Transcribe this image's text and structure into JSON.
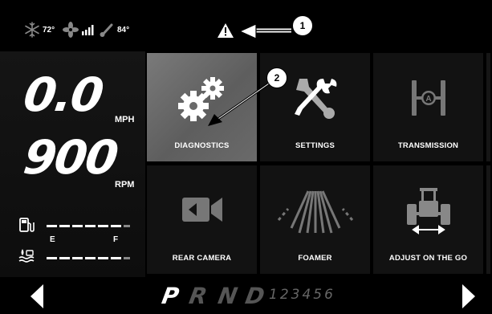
{
  "status": {
    "cab_temp": "72°",
    "fan_level": "",
    "ambient_temp": "84°"
  },
  "speed": {
    "value": "0.0",
    "unit": "MPH"
  },
  "rpm": {
    "value": "900",
    "unit": "RPM"
  },
  "fuel_gauge": {
    "empty_label": "E",
    "full_label": "F"
  },
  "tiles": [
    {
      "label": "DIAGNOSTICS",
      "icon": "gears-icon",
      "selected": true
    },
    {
      "label": "SETTINGS",
      "icon": "wrench-screwdriver-icon"
    },
    {
      "label": "TRANSMISSION",
      "icon": "transmission-icon"
    },
    {
      "label": "REAR CAMERA",
      "icon": "camera-icon"
    },
    {
      "label": "FOAMER",
      "icon": "foamer-icon"
    },
    {
      "label": "ADJUST ON THE GO",
      "icon": "tractor-icon"
    }
  ],
  "gears": {
    "letters": [
      "P",
      "R",
      "N",
      "D"
    ],
    "selected": "P",
    "numbers": "123456"
  },
  "callouts": [
    "1",
    "2"
  ],
  "colors": {
    "selected_tile": "#6b6b6b",
    "background": "#000000"
  }
}
